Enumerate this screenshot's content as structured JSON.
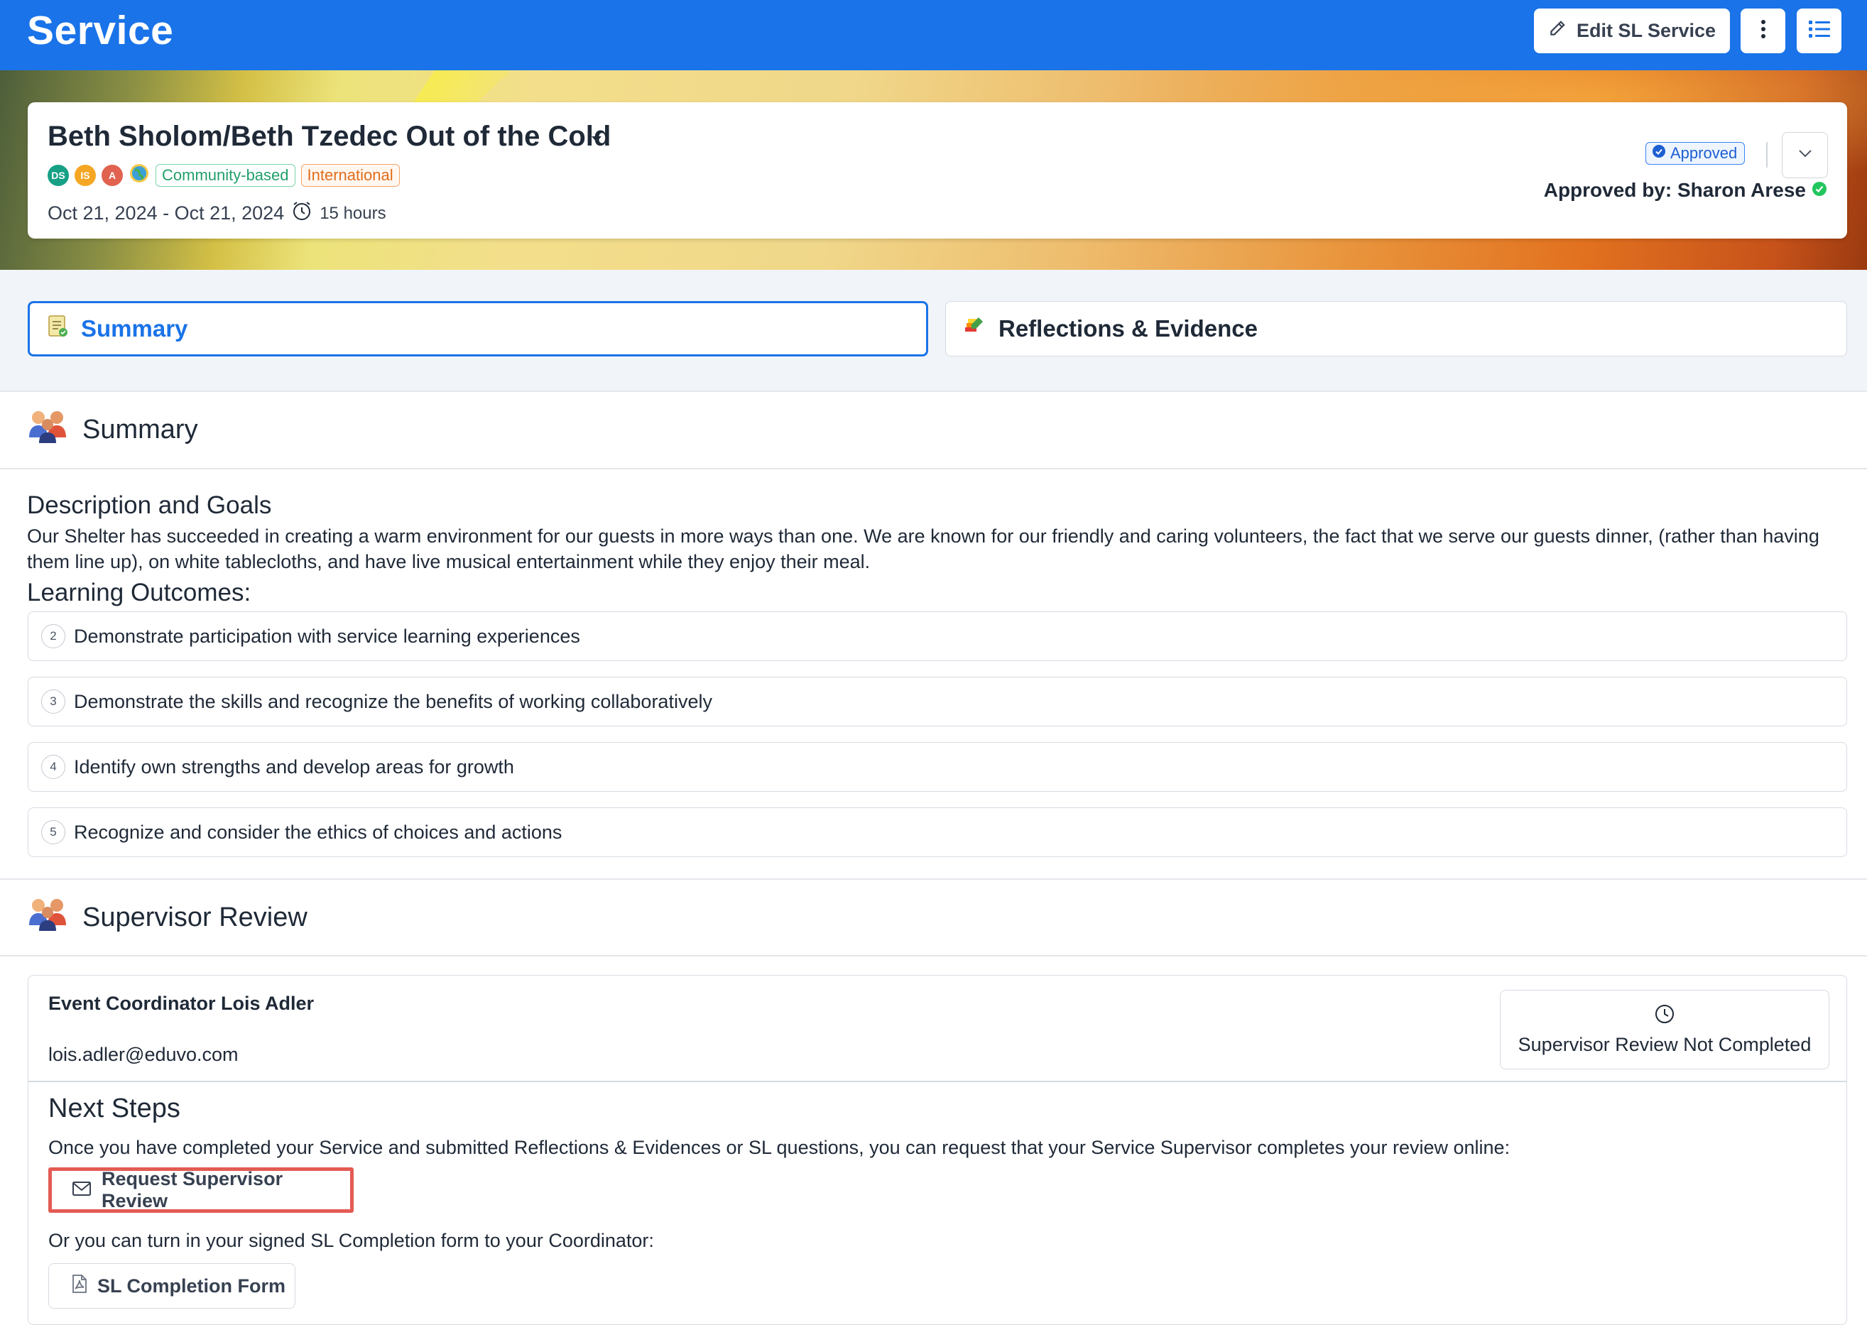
{
  "header": {
    "title": "Service",
    "edit_label": "Edit SL Service",
    "more_icon": "kebab-menu-icon",
    "list_icon": "list-icon"
  },
  "service": {
    "name": "Beth Sholom/Beth Tzedec Out of the Cold",
    "avatars": [
      {
        "initials": "DS",
        "color": "#16a085"
      },
      {
        "initials": "IS",
        "color": "#f5a623"
      },
      {
        "initials": "A",
        "color": "#e0624f"
      }
    ],
    "tags": [
      "Community-based",
      "International"
    ],
    "dates": "Oct 21, 2024 - Oct 21, 2024",
    "hours": "15 hours",
    "status": "Approved",
    "approved_by": "Approved by: Sharon Arese"
  },
  "tabs": [
    {
      "label": "Summary",
      "active": true
    },
    {
      "label": "Reflections & Evidence",
      "active": false
    }
  ],
  "summary": {
    "title": "Summary",
    "description_heading": "Description and Goals",
    "description": "Our Shelter has succeeded in creating a warm environment for our guests in more ways than one. We are known for our friendly and caring volunteers, the fact that we serve our guests dinner, (rather than having them line up), on white tablecloths, and have live musical entertainment while they enjoy their meal.",
    "outcomes_heading": "Learning Outcomes:",
    "outcomes": [
      {
        "num": "2",
        "text": "Demonstrate participation with service learning experiences"
      },
      {
        "num": "3",
        "text": "Demonstrate the skills and recognize the benefits of working collaboratively"
      },
      {
        "num": "4",
        "text": "Identify own strengths and develop areas for growth"
      },
      {
        "num": "5",
        "text": "Recognize and consider the ethics of choices and actions"
      }
    ]
  },
  "supervisor": {
    "title": "Supervisor Review",
    "name": "Event Coordinator Lois Adler",
    "email": "lois.adler@eduvo.com",
    "status": "Supervisor Review Not Completed",
    "next_steps_title": "Next Steps",
    "next_steps_text": "Once you have completed your Service and submitted Reflections & Evidences or SL questions, you can request that your Service Supervisor completes your review online:",
    "request_label": "Request Supervisor Review",
    "alt_text": "Or you can turn in your signed SL Completion form to your Coordinator:",
    "form_label": "SL Completion Form"
  },
  "colors": {
    "brand": "#1a73e8",
    "highlight": "#e35b53",
    "success": "#22c55e"
  }
}
